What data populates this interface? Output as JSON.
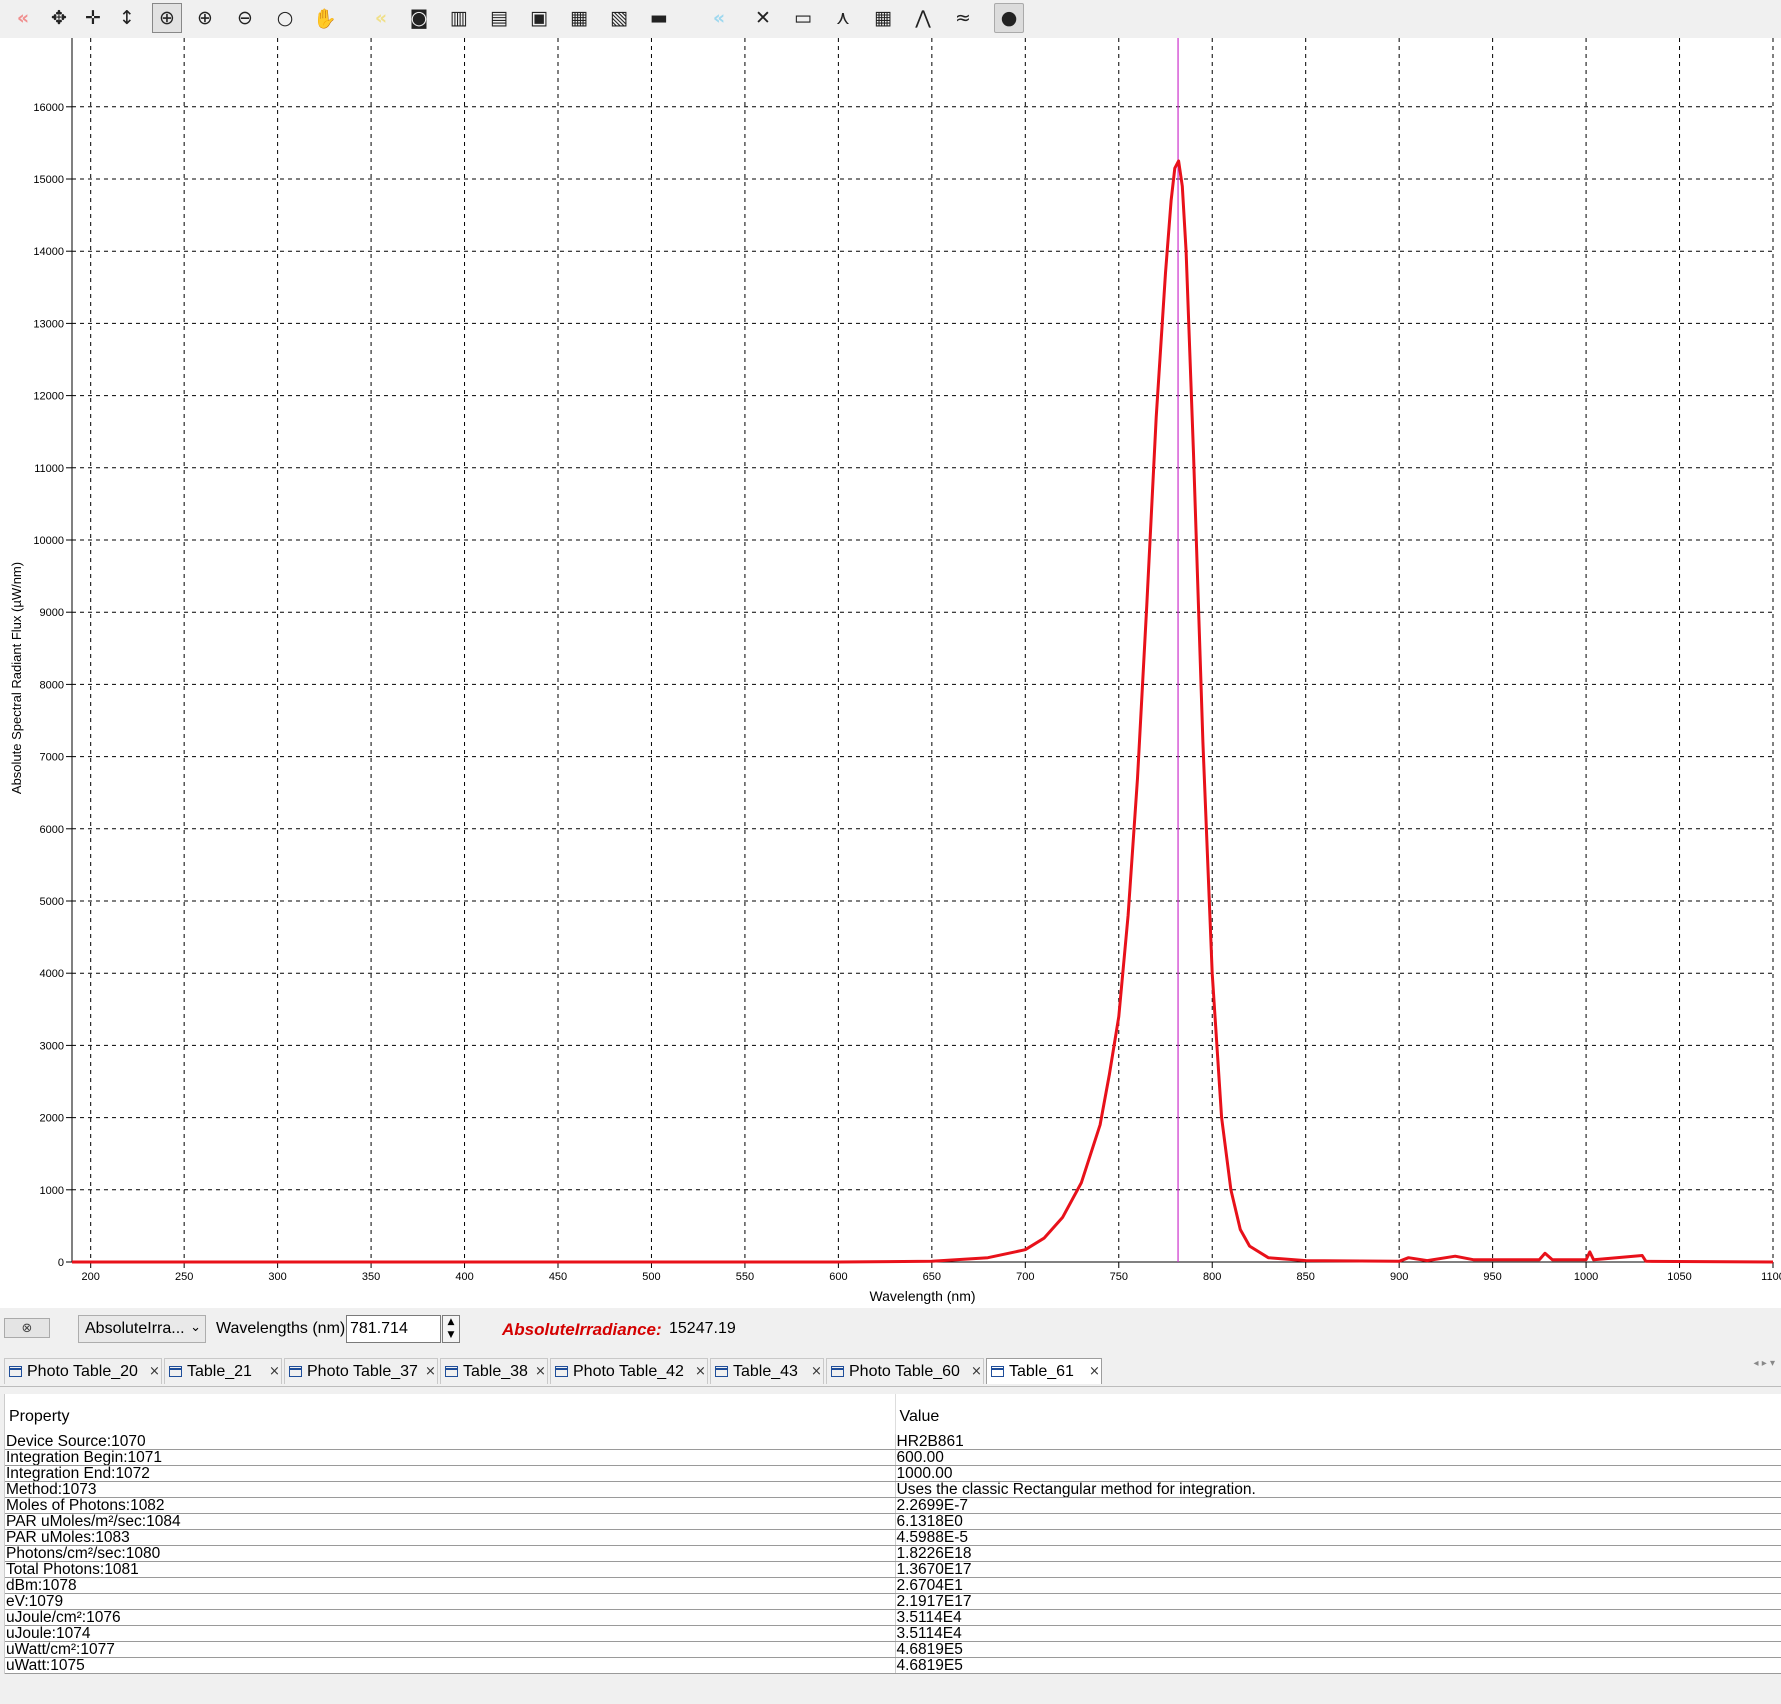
{
  "toolbar": {
    "icons": [
      {
        "name": "back-icon",
        "glyph": "«"
      },
      {
        "name": "move-icon",
        "glyph": "✥"
      },
      {
        "name": "crosshair-icon",
        "glyph": "✛"
      },
      {
        "name": "vertical-arrow-icon",
        "glyph": "↕"
      },
      {
        "name": "zoom-auto-icon",
        "glyph": "⊕"
      },
      {
        "name": "zoom-in-icon",
        "glyph": "⊕"
      },
      {
        "name": "zoom-out-icon",
        "glyph": "⊖"
      },
      {
        "name": "zoom-icon",
        "glyph": "○"
      },
      {
        "name": "pan-hand-icon",
        "glyph": "✋"
      },
      {
        "name": "highlight-icon",
        "glyph": "«"
      },
      {
        "name": "camera-icon",
        "glyph": "◙"
      },
      {
        "name": "trash-icon",
        "glyph": "▥"
      },
      {
        "name": "copy-doc-icon",
        "glyph": "▤"
      },
      {
        "name": "save-icon",
        "glyph": "▣"
      },
      {
        "name": "save-all-icon",
        "glyph": "▦"
      },
      {
        "name": "export-icon",
        "glyph": "▧"
      },
      {
        "name": "print-icon",
        "glyph": "▬"
      },
      {
        "name": "rewind-icon",
        "glyph": "«"
      },
      {
        "name": "tools-icon",
        "glyph": "✕"
      },
      {
        "name": "graph-window-icon",
        "glyph": "▭"
      },
      {
        "name": "peak-marker-icon",
        "glyph": "⋏"
      },
      {
        "name": "table-icon",
        "glyph": "▦"
      },
      {
        "name": "spectrum-icon",
        "glyph": "⋀"
      },
      {
        "name": "multi-spectrum-icon",
        "glyph": "≈"
      },
      {
        "name": "bulb-icon",
        "glyph": "●"
      }
    ]
  },
  "chart_data": {
    "type": "line",
    "xlabel": "Wavelength (nm)",
    "ylabel": "Absolute Spectral Radiant Flux (µW/nm)",
    "xlim": [
      190,
      1100
    ],
    "ylim": [
      0,
      16000
    ],
    "x_ticks": [
      200,
      250,
      300,
      350,
      400,
      450,
      500,
      550,
      600,
      650,
      700,
      750,
      800,
      850,
      900,
      950,
      1000,
      1050,
      1100
    ],
    "y_ticks": [
      0,
      1000,
      2000,
      3000,
      4000,
      5000,
      6000,
      7000,
      8000,
      9000,
      10000,
      11000,
      12000,
      13000,
      14000,
      15000,
      16000
    ],
    "grid": true,
    "line_color": "#e8111a",
    "marker_color": "#cc33cc",
    "marker_x": 781.714,
    "series": [
      {
        "color": "#e8111a",
        "x": [
          190,
          600,
          650,
          680,
          700,
          710,
          720,
          730,
          740,
          745,
          750,
          755,
          760,
          765,
          770,
          775,
          778,
          780,
          782,
          784,
          786,
          790,
          795,
          800,
          805,
          810,
          815,
          820,
          830,
          850,
          900,
          905,
          915,
          930,
          940,
          975,
          978,
          982,
          1000,
          1002,
          1004,
          1030,
          1032,
          1100
        ],
        "y": [
          0,
          0,
          10,
          60,
          170,
          330,
          620,
          1100,
          1900,
          2600,
          3400,
          4800,
          6700,
          9100,
          11700,
          13700,
          14700,
          15150,
          15250,
          14900,
          14000,
          11200,
          7200,
          4000,
          2000,
          1000,
          450,
          220,
          60,
          20,
          10,
          60,
          20,
          80,
          30,
          30,
          120,
          30,
          30,
          140,
          30,
          90,
          10,
          0
        ]
      }
    ]
  },
  "controls": {
    "quantity_select": "AbsoluteIrra...",
    "wavelength_label": "Wavelengths (nm)",
    "wavelength_value": "781.714",
    "readout_label": "AbsoluteIrradiance:",
    "readout_value": "15247.19"
  },
  "tabs": [
    {
      "label": "Photo Table_20"
    },
    {
      "label": "Table_21"
    },
    {
      "label": "Photo Table_37"
    },
    {
      "label": "Table_38"
    },
    {
      "label": "Photo Table_42"
    },
    {
      "label": "Table_43"
    },
    {
      "label": "Photo Table_60"
    },
    {
      "label": "Table_61"
    }
  ],
  "table": {
    "headers": [
      "Property",
      "Value"
    ],
    "rows": [
      [
        "Device Source:1070",
        "HR2B861"
      ],
      [
        "Integration Begin:1071",
        "600.00"
      ],
      [
        "Integration End:1072",
        "1000.00"
      ],
      [
        "Method:1073",
        "Uses the classic Rectangular method for integration."
      ],
      [
        "Moles of Photons:1082",
        "2.2699E-7"
      ],
      [
        "PAR uMoles/m²/sec:1084",
        "6.1318E0"
      ],
      [
        "PAR uMoles:1083",
        "4.5988E-5"
      ],
      [
        "Photons/cm²/sec:1080",
        "1.8226E18"
      ],
      [
        "Total Photons:1081",
        "1.3670E17"
      ],
      [
        "dBm:1078",
        "2.6704E1"
      ],
      [
        "eV:1079",
        "2.1917E17"
      ],
      [
        "uJoule/cm²:1076",
        "3.5114E4"
      ],
      [
        "uJoule:1074",
        "3.5114E4"
      ],
      [
        "uWatt/cm²:1077",
        "4.6819E5"
      ],
      [
        "uWatt:1075",
        "4.6819E5"
      ]
    ]
  }
}
